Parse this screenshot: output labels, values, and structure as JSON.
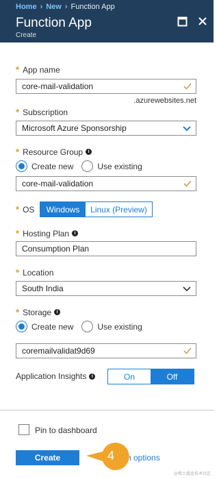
{
  "breadcrumb": {
    "home": "Home",
    "new": "New",
    "current": "Function App"
  },
  "header": {
    "title": "Function App",
    "subtitle": "Create"
  },
  "form": {
    "app_name": {
      "label": "App name",
      "value": "core-mail-validation",
      "suffix": ".azurewebsites.net"
    },
    "subscription": {
      "label": "Subscription",
      "value": "Microsoft Azure Sponsorship"
    },
    "resource_group": {
      "label": "Resource Group",
      "create_new": "Create new",
      "use_existing": "Use existing",
      "selected": "create_new",
      "value": "core-mail-validation"
    },
    "os": {
      "label": "OS",
      "options": [
        "Windows",
        "Linux (Preview)"
      ],
      "selected": "Windows"
    },
    "hosting_plan": {
      "label": "Hosting Plan",
      "value": "Consumption Plan"
    },
    "location": {
      "label": "Location",
      "value": "South India"
    },
    "storage": {
      "label": "Storage",
      "create_new": "Create new",
      "use_existing": "Use existing",
      "selected": "create_new",
      "value": "coremailvalidat9d69"
    },
    "app_insights": {
      "label": "Application Insights",
      "options": [
        "On",
        "Off"
      ],
      "selected": "Off"
    }
  },
  "footer": {
    "pin_label": "Pin to dashboard",
    "pinned": false,
    "create_label": "Create",
    "automation_link": "n options"
  },
  "callout": {
    "number": "4",
    "color": "#f0a42a"
  },
  "watermark": "@稀土掘金技术社区",
  "colors": {
    "header_bg": "#213f5c",
    "accent": "#1e7dd5",
    "required": "#d6a11c",
    "valid_check": "#c8a050"
  }
}
